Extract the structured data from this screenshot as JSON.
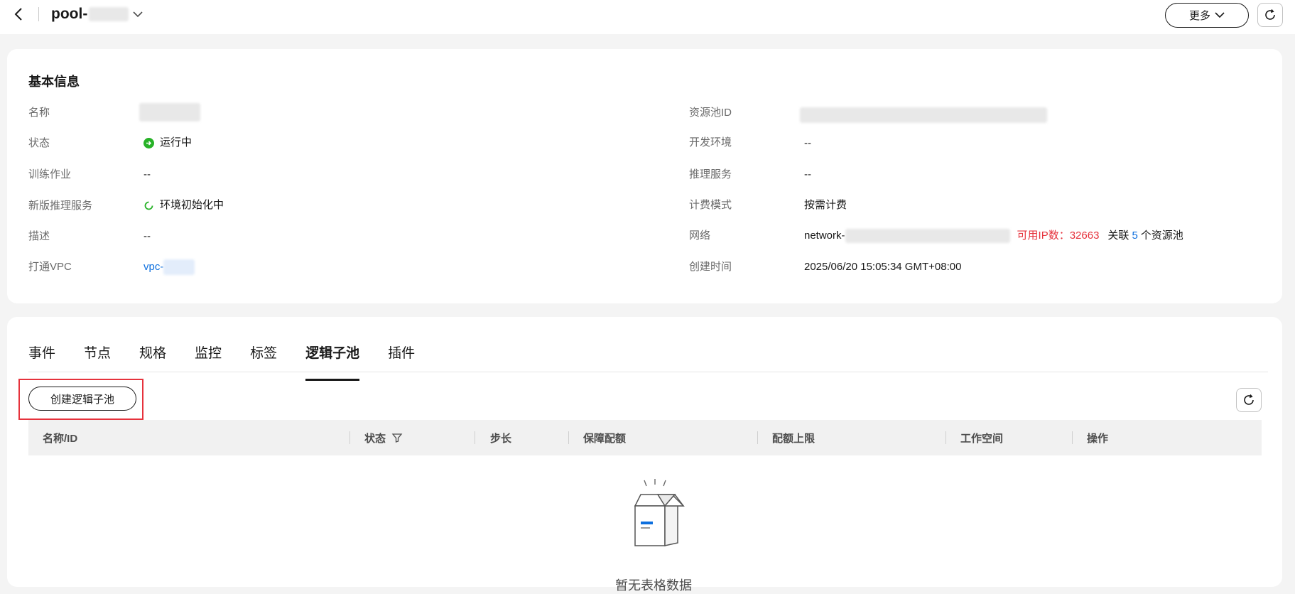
{
  "header": {
    "title_prefix": "pool-",
    "more_label": "更多"
  },
  "basic_info": {
    "section_title": "基本信息",
    "left": [
      {
        "label": "名称",
        "value": ""
      },
      {
        "label": "状态",
        "value": "运行中"
      },
      {
        "label": "训练作业",
        "value": "--"
      },
      {
        "label": "新版推理服务",
        "value": "环境初始化中"
      },
      {
        "label": "描述",
        "value": "--"
      },
      {
        "label": "打通VPC",
        "value": "vpc-"
      }
    ],
    "right": [
      {
        "label": "资源池ID",
        "value": ""
      },
      {
        "label": "开发环境",
        "value": "--"
      },
      {
        "label": "推理服务",
        "value": "--"
      },
      {
        "label": "计费模式",
        "value": "按需计费"
      },
      {
        "label": "网络",
        "value": "network-"
      },
      {
        "label": "创建时间",
        "value": "2025/06/20 15:05:34 GMT+08:00"
      }
    ],
    "network_extra": {
      "available_ip_label": "可用IP数：32663",
      "linked_prefix": "关联",
      "linked_count": "5",
      "linked_suffix": "个资源池"
    }
  },
  "tabs": [
    {
      "label": "事件",
      "active": false
    },
    {
      "label": "节点",
      "active": false
    },
    {
      "label": "规格",
      "active": false
    },
    {
      "label": "监控",
      "active": false
    },
    {
      "label": "标签",
      "active": false
    },
    {
      "label": "逻辑子池",
      "active": true
    },
    {
      "label": "插件",
      "active": false
    }
  ],
  "table": {
    "create_button_label": "创建逻辑子池",
    "columns": [
      "名称/ID",
      "状态",
      "步长",
      "保障配额",
      "配额上限",
      "工作空间",
      "操作"
    ],
    "empty_text": "暂无表格数据"
  },
  "colors": {
    "accent_blue": "#0d6fde",
    "status_green": "#27b227",
    "alert_red": "#e6323c"
  }
}
